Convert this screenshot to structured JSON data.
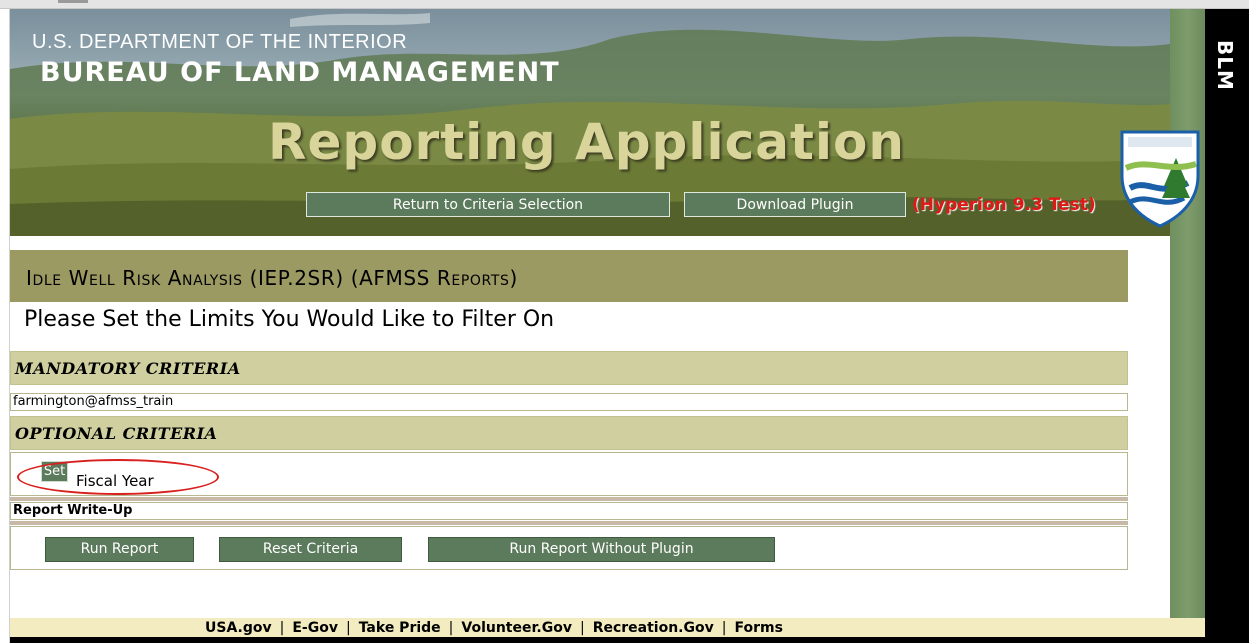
{
  "banner": {
    "department": "U.S. DEPARTMENT OF THE INTERIOR",
    "bureau": "BUREAU OF LAND MANAGEMENT",
    "app_title": "Reporting Application",
    "return_label": "Return to Criteria Selection",
    "download_label": "Download Plugin",
    "environment_label": "(Hyperion 9.3 Test)",
    "side_label": "BLM"
  },
  "report": {
    "title": "Idle Well Risk Analysis (IEP.2SR) (AFMSS Reports)",
    "subtitle": "Please Set the Limits You Would Like to Filter On"
  },
  "mandatory": {
    "heading": "MANDATORY CRITERIA",
    "value": "farmington@afmss_train"
  },
  "optional": {
    "heading": "OPTIONAL CRITERIA",
    "set_label": "Set",
    "field_label": "Fiscal Year"
  },
  "writeup": {
    "label": "Report Write-Up"
  },
  "actions": {
    "run_label": "Run Report",
    "reset_label": "Reset Criteria",
    "run_without_plugin_label": "Run Report Without Plugin"
  },
  "footer": {
    "links": [
      "USA.gov",
      "E-Gov",
      "Take Pride",
      "Volunteer.Gov",
      "Recreation.Gov",
      "Forms"
    ]
  },
  "colors": {
    "button_green": "#5c7a5c",
    "title_bar": "#9c9a63",
    "section_header": "#cfcf9f",
    "highlight_circle": "#d8201e",
    "environment_red": "#e01818"
  }
}
